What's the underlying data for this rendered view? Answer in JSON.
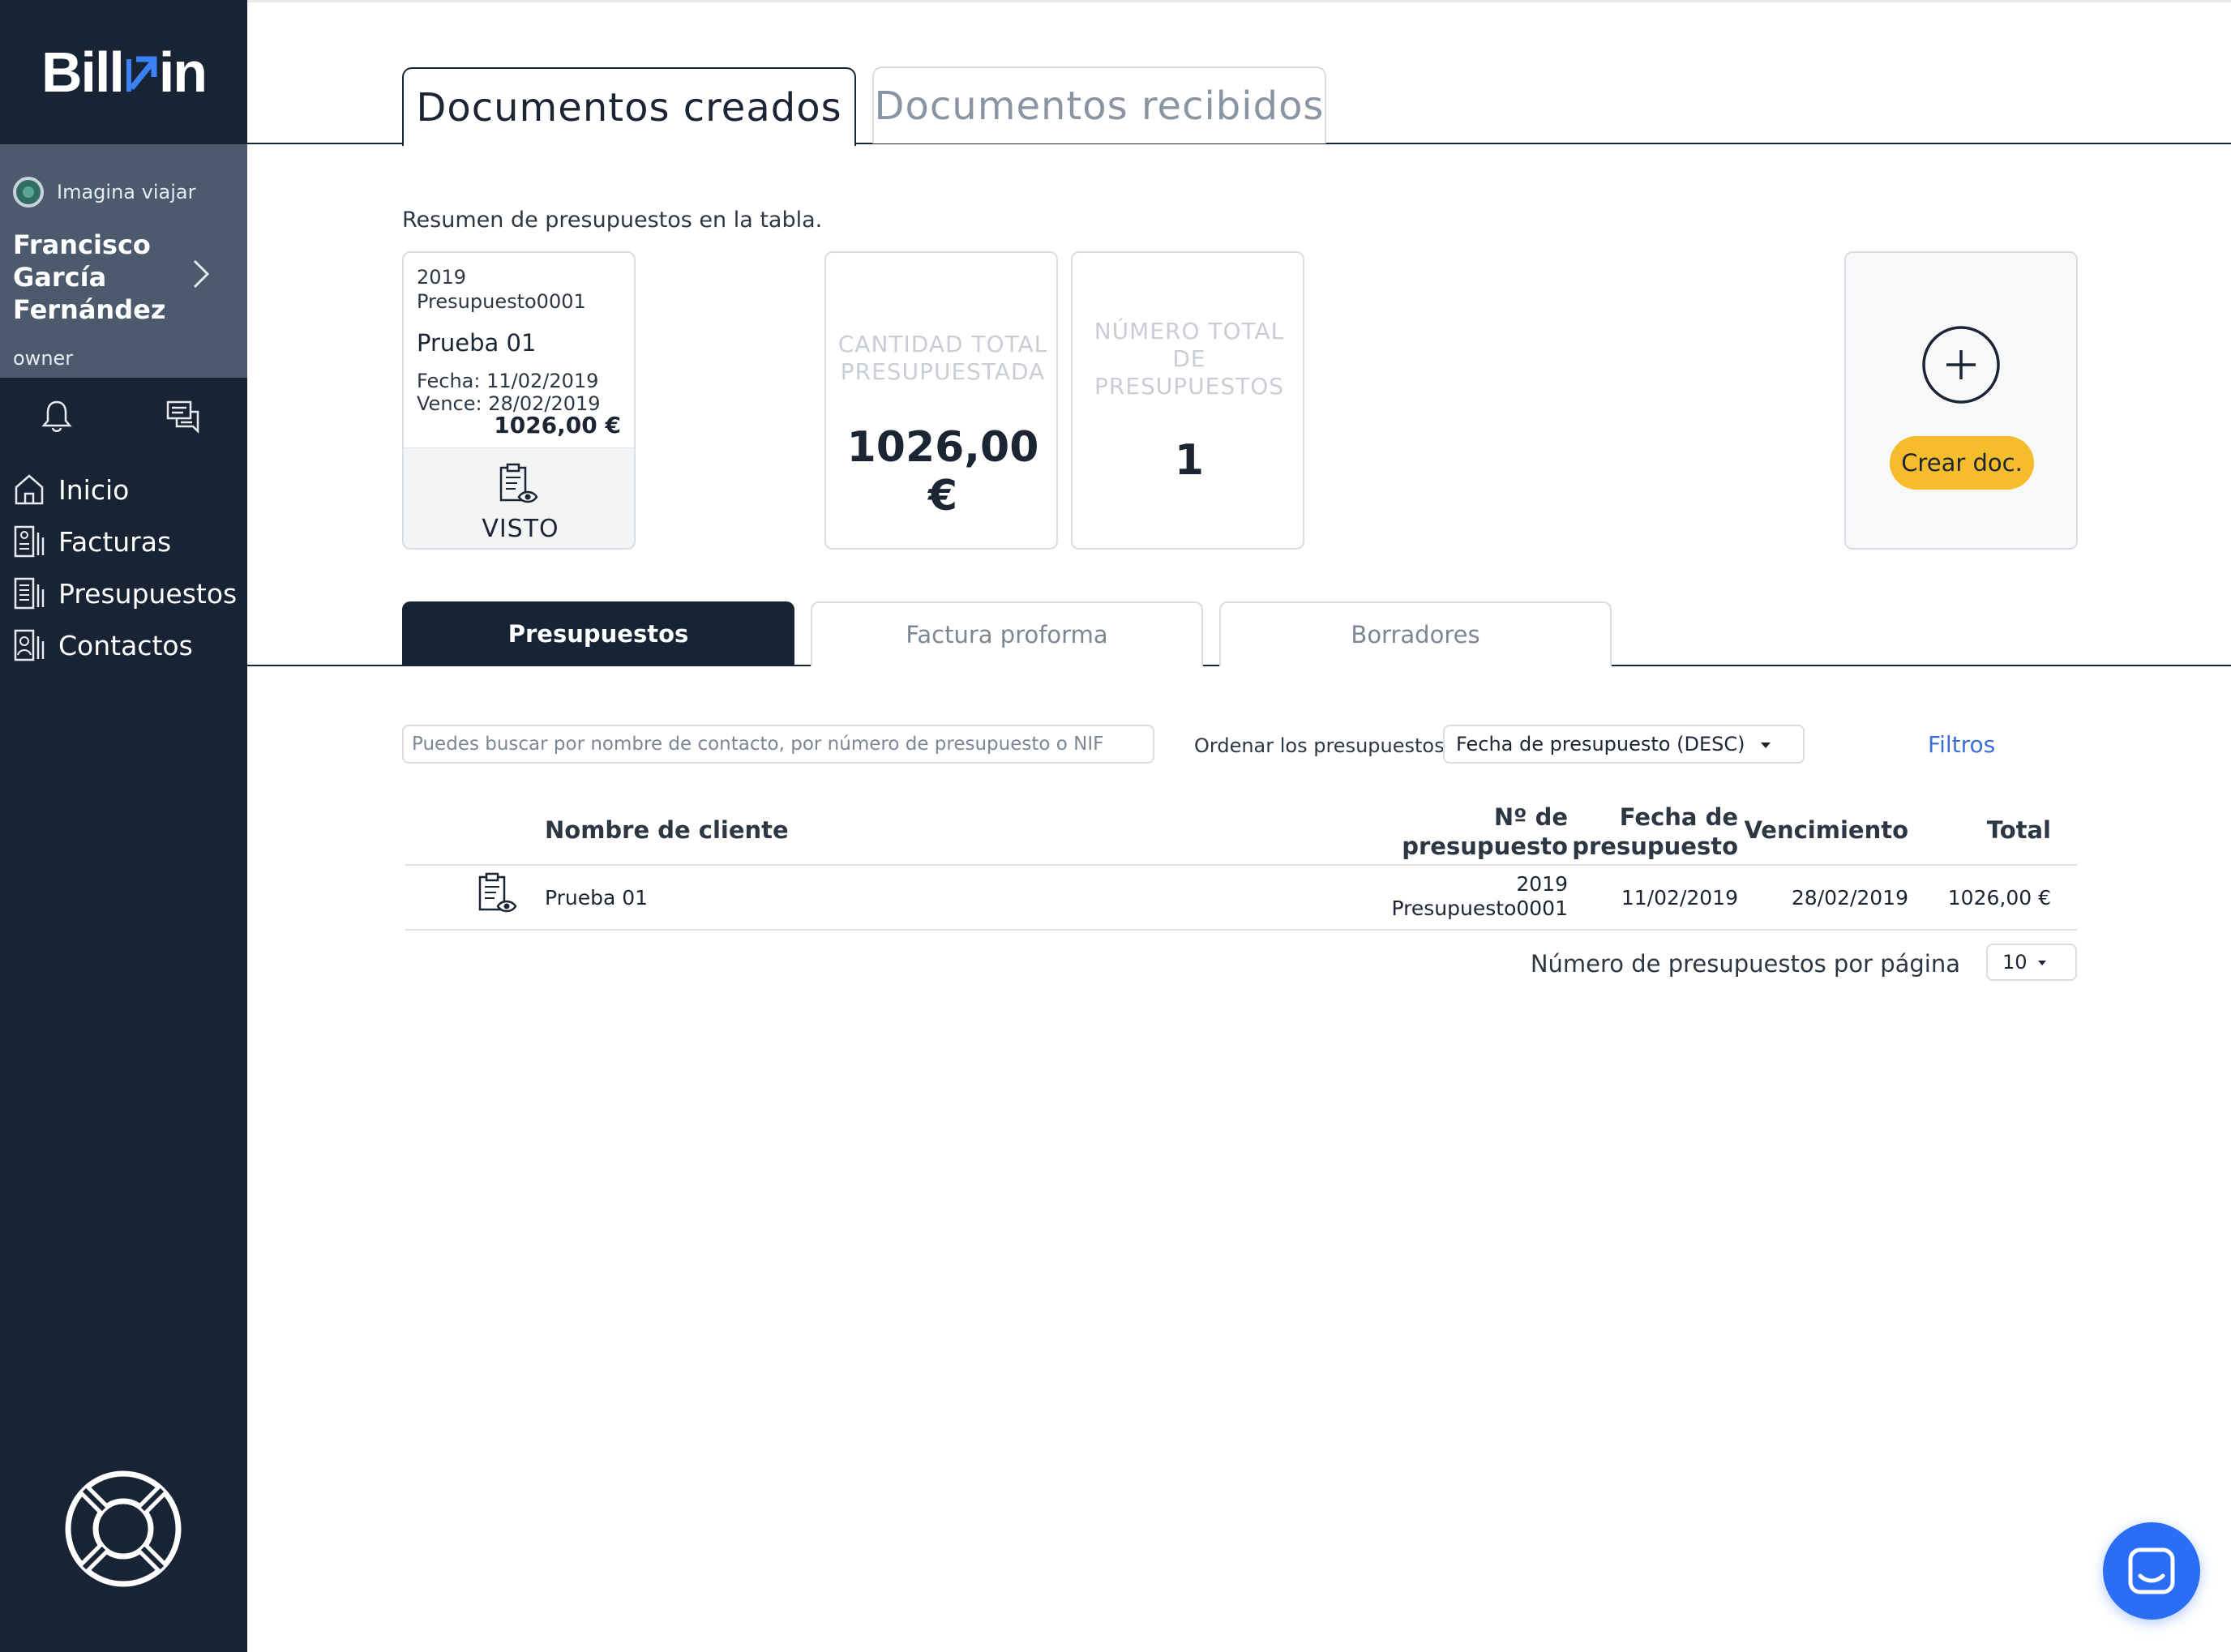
{
  "app": {
    "logo": "Billin",
    "logo_left": "Bill",
    "logo_right": "in",
    "brand_color": "#182434",
    "accent_color": "#f7bc2c",
    "link_color": "#3b6fd8"
  },
  "sidebar": {
    "company": "Imagina viajar",
    "user_name": "Francisco García Fernández",
    "role": "owner",
    "icons": [
      "bell-icon",
      "chat-icon"
    ],
    "items": [
      {
        "label": "Inicio",
        "icon": "home-icon"
      },
      {
        "label": "Facturas",
        "icon": "invoice-icon"
      },
      {
        "label": "Presupuestos",
        "icon": "budget-icon"
      },
      {
        "label": "Contactos",
        "icon": "contacts-icon"
      }
    ],
    "help_icon": "lifebuoy-icon"
  },
  "doc_tabs": [
    {
      "label": "Documentos creados",
      "active": true
    },
    {
      "label": "Documentos recibidos",
      "active": false
    }
  ],
  "summary": {
    "text": "Resumen de presupuestos en la tabla.",
    "doc_card": {
      "year": "2019",
      "number": "Presupuesto0001",
      "title": "Prueba 01",
      "fecha": "Fecha: 11/02/2019",
      "vence": "Vence: 28/02/2019",
      "amount": "1026,00 €",
      "status": "VISTO"
    },
    "stats": [
      {
        "label": "CANTIDAD TOTAL PRESUPUESTADA",
        "value": "1026,00 €"
      },
      {
        "label": "NÚMERO TOTAL DE PRESUPUESTOS",
        "value": "1"
      }
    ],
    "create_label": "Crear doc."
  },
  "sub_tabs": [
    {
      "label": "Presupuestos",
      "active": true
    },
    {
      "label": "Factura proforma",
      "active": false
    },
    {
      "label": "Borradores",
      "active": false
    }
  ],
  "controls": {
    "search_placeholder": "Puedes buscar por nombre de contacto, por número de presupuesto o NIF",
    "sort_label": "Ordenar los presupuestos",
    "sort_value": "Fecha de presupuesto (DESC)",
    "filters_label": "Filtros"
  },
  "table": {
    "headers": {
      "name": "Nombre de cliente",
      "number": "Nº de presupuesto",
      "date": "Fecha de presupuesto",
      "due": "Vencimiento",
      "total": "Total"
    },
    "rows": [
      {
        "name": "Prueba 01",
        "number_year": "2019",
        "number": "Presupuesto0001",
        "date": "11/02/2019",
        "due": "28/02/2019",
        "total": "1026,00 €"
      }
    ]
  },
  "pagination": {
    "label": "Número de presupuestos por página",
    "value": "10"
  }
}
